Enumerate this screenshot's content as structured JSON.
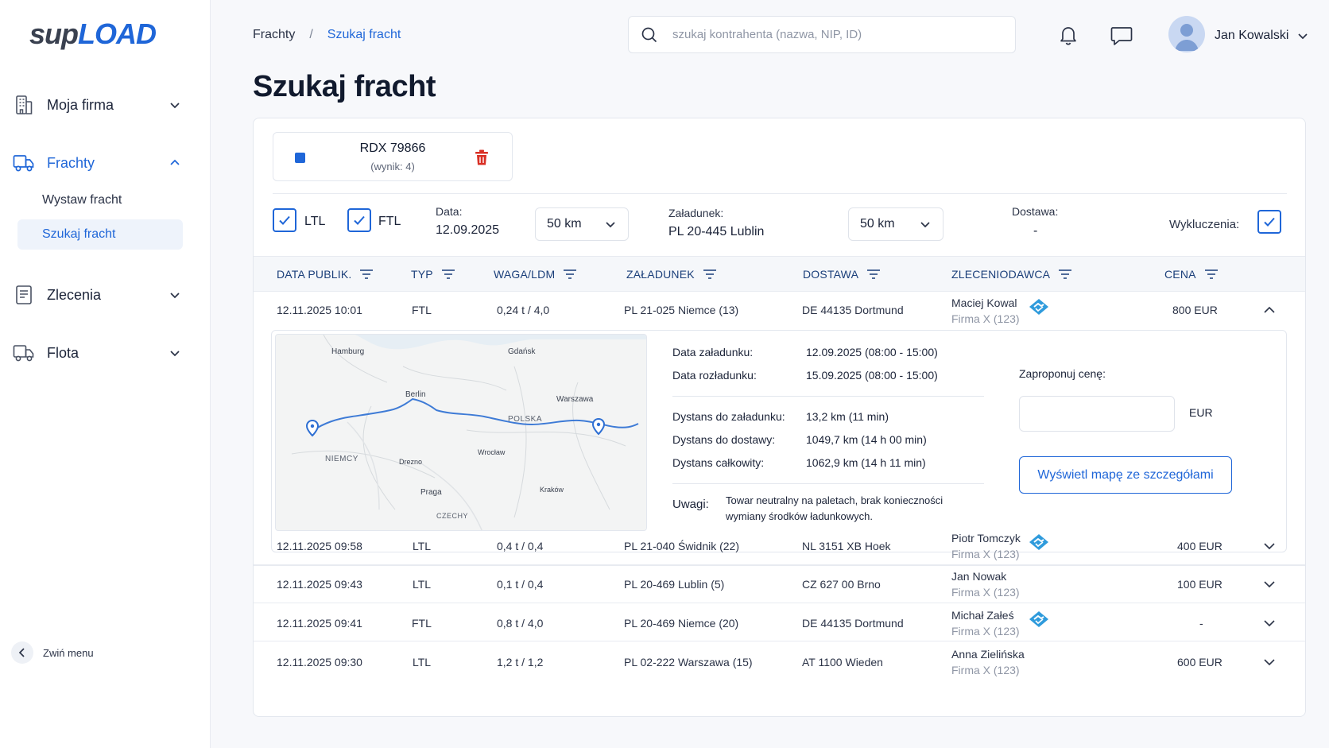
{
  "logo": {
    "part1": "sup",
    "part2": "LOAD"
  },
  "sidebar": {
    "items": [
      {
        "label": "Moja firma",
        "icon": "building-icon"
      },
      {
        "label": "Frachty",
        "icon": "truck-icon"
      },
      {
        "label": "Zlecenia",
        "icon": "document-icon"
      },
      {
        "label": "Flota",
        "icon": "truck-icon"
      }
    ],
    "sub_items": [
      {
        "label": "Wystaw fracht"
      },
      {
        "label": "Szukaj fracht"
      }
    ],
    "collapse_label": "Zwiń menu"
  },
  "breadcrumb": {
    "root": "Frachty",
    "separator": "/",
    "current": "Szukaj fracht"
  },
  "search": {
    "placeholder": "szukaj kontrahenta (nazwa, NIP, ID)"
  },
  "user": {
    "name": "Jan Kowalski"
  },
  "page_title": "Szukaj fracht",
  "saved_search": {
    "name": "RDX 79866",
    "result": "(wynik: 4)"
  },
  "filters": {
    "ltl_label": "LTL",
    "ftl_label": "FTL",
    "date_label": "Data:",
    "date_value": "12.09.2025",
    "date_radius": "50 km",
    "loading_label": "Załadunek:",
    "loading_value": "PL 20-445 Lublin",
    "loading_radius": "50 km",
    "delivery_label": "Dostawa:",
    "delivery_value": "-",
    "exclusions_label": "Wykluczenia:"
  },
  "table": {
    "columns": [
      "DATA PUBLIK.",
      "TYP",
      "WAGA/LDM",
      "ZAŁADUNEK",
      "DOSTAWA",
      "ZLECENIODAWCA",
      "CENA"
    ],
    "rows": [
      {
        "date": "12.11.2025 10:01",
        "type": "FTL",
        "weight": "0,24 t / 4,0",
        "loading": "PL 21-025 Niemce (13)",
        "delivery": "DE 44135 Dortmund",
        "client": "Maciej Kowal",
        "firm": "Firma X (123)",
        "price": "800 EUR"
      },
      {
        "date": "12.11.2025 09:58",
        "type": "LTL",
        "weight": "0,4 t / 0,4",
        "loading": "PL 21-040 Świdnik (22)",
        "delivery": "NL 3151 XB Hoek",
        "client": "Piotr Tomczyk",
        "firm": "Firma X (123)",
        "price": "400 EUR"
      },
      {
        "date": "12.11.2025 09:43",
        "type": "LTL",
        "weight": "0,1 t / 0,4",
        "loading": "PL 20-469 Lublin (5)",
        "delivery": "CZ 627 00 Brno",
        "client": "Jan Nowak",
        "firm": "Firma X (123)",
        "price": "100 EUR"
      },
      {
        "date": "12.11.2025 09:41",
        "type": "FTL",
        "weight": "0,8 t / 4,0",
        "loading": "PL 20-469 Niemce (20)",
        "delivery": "DE 44135 Dortmund",
        "client": "Michał Załeś",
        "firm": "Firma X (123)",
        "price": "-"
      },
      {
        "date": "12.11.2025 09:30",
        "type": "LTL",
        "weight": "1,2 t / 1,2",
        "loading": "PL 02-222 Warszawa (15)",
        "delivery": "AT 1100 Wieden",
        "client": "Anna Zielińska",
        "firm": "Firma X (123)",
        "price": "600 EUR"
      }
    ]
  },
  "detail": {
    "map_labels": {
      "hamburg": "Hamburg",
      "gdansk": "Gdańsk",
      "berlin": "Berlin",
      "warszawa": "Warszawa",
      "polska": "POLSKA",
      "niemcy": "NIEMCY",
      "drezno": "Drezno",
      "wroclaw": "Wrocław",
      "praga": "Praga",
      "krakow": "Kraków",
      "czechy": "CZECHY"
    },
    "loading_date_label": "Data załadunku:",
    "loading_date_value": "12.09.2025 (08:00 - 15:00)",
    "unloading_date_label": "Data rozładunku:",
    "unloading_date_value": "15.09.2025 (08:00 - 15:00)",
    "dist_loading_label": "Dystans do załadunku:",
    "dist_loading_value": "13,2 km (11 min)",
    "dist_delivery_label": "Dystans do dostawy:",
    "dist_delivery_value": "1049,7 km (14 h 00 min)",
    "dist_total_label": "Dystans całkowity:",
    "dist_total_value": "1062,9 km (14 h 11 min)",
    "notes_label": "Uwagi:",
    "notes_line1": "Towar neutralny na paletach, brak konieczności",
    "notes_line2": "wymiany środków ładunkowych.",
    "offer_label": "Zaproponuj cenę:",
    "currency": "EUR",
    "map_button": "Wyświetl mapę ze szczegółami"
  },
  "colors": {
    "accent": "#1f66d8",
    "delete": "#d93025"
  }
}
